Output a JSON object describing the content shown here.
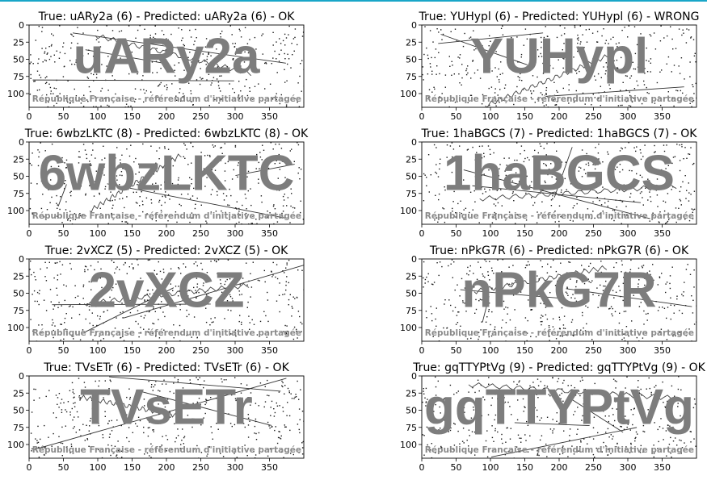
{
  "figure": {
    "background": "#ffffff",
    "accent_rule_color": "#19a6c8",
    "captcha_text_color": "#7d7d7d",
    "noise_color": "#1a1a1a"
  },
  "chart_data": [
    {
      "type": "image",
      "title": "True: uARy2a (6) - Predicted: uARy2a (6) - OK",
      "captcha_text": "uARy2a",
      "watermark": "République Française - référendum d'initiative partagée",
      "xlim": [
        0,
        400
      ],
      "ylim": [
        120,
        0
      ],
      "xticks": [
        0,
        50,
        100,
        150,
        200,
        250,
        300,
        350
      ],
      "yticks": [
        0,
        25,
        50,
        75,
        100
      ]
    },
    {
      "type": "image",
      "title": "True: YUHypl (6) - Predicted: YUHypl (6) - WRONG",
      "captcha_text": "YUHypl",
      "watermark": "République Française - référendum d'initiative partagée",
      "xlim": [
        0,
        400
      ],
      "ylim": [
        120,
        0
      ],
      "xticks": [
        0,
        50,
        100,
        150,
        200,
        250,
        300,
        350
      ],
      "yticks": [
        0,
        25,
        50,
        75,
        100
      ]
    },
    {
      "type": "image",
      "title": "True: 6wbzLKTC (8) - Predicted: 6wbzLKTC (8) - OK",
      "captcha_text": "6wbzLKTC",
      "watermark": "République Française - référendum d'initiative partagée",
      "xlim": [
        0,
        400
      ],
      "ylim": [
        120,
        0
      ],
      "xticks": [
        0,
        50,
        100,
        150,
        200,
        250,
        300,
        350
      ],
      "yticks": [
        0,
        25,
        50,
        75,
        100
      ]
    },
    {
      "type": "image",
      "title": "True: 1haBGCS (7) - Predicted: 1haBGCS (7) - OK",
      "captcha_text": "1haBGCS",
      "watermark": "République Française - référendum d'initiative partagée",
      "xlim": [
        0,
        400
      ],
      "ylim": [
        120,
        0
      ],
      "xticks": [
        0,
        50,
        100,
        150,
        200,
        250,
        300,
        350
      ],
      "yticks": [
        0,
        25,
        50,
        75,
        100
      ]
    },
    {
      "type": "image",
      "title": "True: 2vXCZ (5) - Predicted: 2vXCZ (5) - OK",
      "captcha_text": "2vXCZ",
      "watermark": "République Française - référendum d'initiative partagée",
      "xlim": [
        0,
        400
      ],
      "ylim": [
        120,
        0
      ],
      "xticks": [
        0,
        50,
        100,
        150,
        200,
        250,
        300,
        350
      ],
      "yticks": [
        0,
        25,
        50,
        75,
        100
      ]
    },
    {
      "type": "image",
      "title": "True: nPkG7R (6) - Predicted: nPkG7R (6) - OK",
      "captcha_text": "nPkG7R",
      "watermark": "République Française - référendum d'initiative partagée",
      "xlim": [
        0,
        400
      ],
      "ylim": [
        120,
        0
      ],
      "xticks": [
        0,
        50,
        100,
        150,
        200,
        250,
        300,
        350
      ],
      "yticks": [
        0,
        25,
        50,
        75,
        100
      ]
    },
    {
      "type": "image",
      "title": "True: TVsETr (6) - Predicted: TVsETr (6) - OK",
      "captcha_text": "TVsETr",
      "watermark": "République Française - référendum d'initiative partagée",
      "xlim": [
        0,
        400
      ],
      "ylim": [
        120,
        0
      ],
      "xticks": [
        0,
        50,
        100,
        150,
        200,
        250,
        300,
        350
      ],
      "yticks": [
        0,
        25,
        50,
        75,
        100
      ]
    },
    {
      "type": "image",
      "title": "True: gqTTYPtVg (9) - Predicted: gqTTYPtVg (9) - OK",
      "captcha_text": "gqTTYPtVg",
      "watermark": "République Française - référendum d'initiative partagée",
      "xlim": [
        0,
        400
      ],
      "ylim": [
        120,
        0
      ],
      "xticks": [
        0,
        50,
        100,
        150,
        200,
        250,
        300,
        350
      ],
      "yticks": [
        0,
        25,
        50,
        75,
        100
      ]
    }
  ]
}
